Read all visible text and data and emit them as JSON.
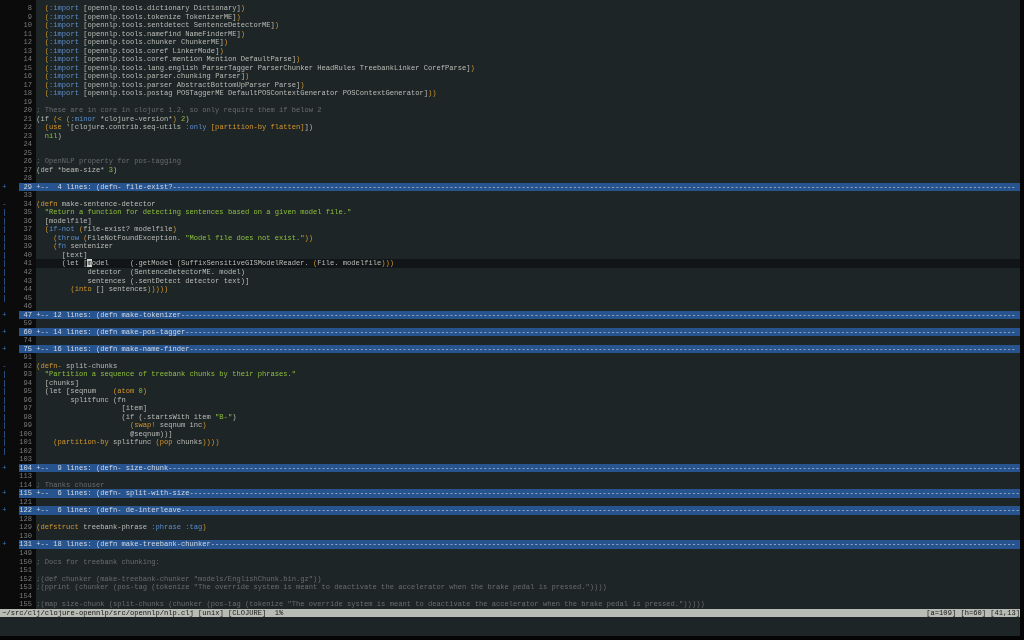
{
  "lines": [
    {
      "kind": "code",
      "number": "8",
      "current": false,
      "tokens": [
        {
          "kind": "paren",
          "text": "  ("
        },
        {
          "kind": "keyword",
          "text": ":import"
        },
        {
          "kind": "plain",
          "text": " [opennlp.tools.dictionary Dictionary]"
        },
        {
          "kind": "paren",
          "text": ")"
        }
      ]
    },
    {
      "kind": "code",
      "number": "9",
      "current": false,
      "tokens": [
        {
          "kind": "paren",
          "text": "  ("
        },
        {
          "kind": "keyword",
          "text": ":import"
        },
        {
          "kind": "plain",
          "text": " [opennlp.tools.tokenize TokenizerME]"
        },
        {
          "kind": "paren",
          "text": ")"
        }
      ]
    },
    {
      "kind": "code",
      "number": "10",
      "current": false,
      "tokens": [
        {
          "kind": "paren",
          "text": "  ("
        },
        {
          "kind": "keyword",
          "text": ":import"
        },
        {
          "kind": "plain",
          "text": " [opennlp.tools.sentdetect SentenceDetectorME]"
        },
        {
          "kind": "paren",
          "text": ")"
        }
      ]
    },
    {
      "kind": "code",
      "number": "11",
      "current": false,
      "tokens": [
        {
          "kind": "paren",
          "text": "  ("
        },
        {
          "kind": "keyword",
          "text": ":import"
        },
        {
          "kind": "plain",
          "text": " [opennlp.tools.namefind NameFinderME]"
        },
        {
          "kind": "paren",
          "text": ")"
        }
      ]
    },
    {
      "kind": "code",
      "number": "12",
      "current": false,
      "tokens": [
        {
          "kind": "paren",
          "text": "  ("
        },
        {
          "kind": "keyword",
          "text": ":import"
        },
        {
          "kind": "plain",
          "text": " [opennlp.tools.chunker ChunkerME]"
        },
        {
          "kind": "paren",
          "text": ")"
        }
      ]
    },
    {
      "kind": "code",
      "number": "13",
      "current": false,
      "tokens": [
        {
          "kind": "paren",
          "text": "  ("
        },
        {
          "kind": "keyword",
          "text": ":import"
        },
        {
          "kind": "plain",
          "text": " [opennlp.tools.coref LinkerMode]"
        },
        {
          "kind": "paren",
          "text": ")"
        }
      ]
    },
    {
      "kind": "code",
      "number": "14",
      "current": false,
      "tokens": [
        {
          "kind": "paren",
          "text": "  ("
        },
        {
          "kind": "keyword",
          "text": ":import"
        },
        {
          "kind": "plain",
          "text": " [opennlp.tools.coref.mention Mention DefaultParse]"
        },
        {
          "kind": "paren",
          "text": ")"
        }
      ]
    },
    {
      "kind": "code",
      "number": "15",
      "current": false,
      "tokens": [
        {
          "kind": "paren",
          "text": "  ("
        },
        {
          "kind": "keyword",
          "text": ":import"
        },
        {
          "kind": "plain",
          "text": " [opennlp.tools.lang.english ParserTagger ParserChunker HeadRules TreebankLinker CorefParse]"
        },
        {
          "kind": "paren",
          "text": ")"
        }
      ]
    },
    {
      "kind": "code",
      "number": "16",
      "current": false,
      "tokens": [
        {
          "kind": "paren",
          "text": "  ("
        },
        {
          "kind": "keyword",
          "text": ":import"
        },
        {
          "kind": "plain",
          "text": " [opennlp.tools.parser.chunking Parser]"
        },
        {
          "kind": "paren",
          "text": ")"
        }
      ]
    },
    {
      "kind": "code",
      "number": "17",
      "current": false,
      "tokens": [
        {
          "kind": "paren",
          "text": "  ("
        },
        {
          "kind": "keyword",
          "text": ":import"
        },
        {
          "kind": "plain",
          "text": " [opennlp.tools.parser AbstractBottomUpParser Parse]"
        },
        {
          "kind": "paren",
          "text": ")"
        }
      ]
    },
    {
      "kind": "code",
      "number": "18",
      "current": false,
      "tokens": [
        {
          "kind": "paren",
          "text": "  ("
        },
        {
          "kind": "keyword",
          "text": ":import"
        },
        {
          "kind": "plain",
          "text": " [opennlp.tools.postag POSTaggerME DefaultPOSContextGenerator POSContextGenerator]"
        },
        {
          "kind": "paren",
          "text": "))"
        }
      ]
    },
    {
      "kind": "code",
      "number": "19",
      "current": false
    },
    {
      "kind": "code",
      "number": "20",
      "current": false,
      "tokens": [
        {
          "kind": "comment",
          "text": "; These are in core in clojure 1.2, so only require them if below 2"
        }
      ]
    },
    {
      "kind": "code",
      "number": "21",
      "current": false,
      "tokens": [
        {
          "kind": "plain",
          "text": "(if "
        },
        {
          "kind": "paren",
          "text": "(<"
        },
        {
          "kind": "paren",
          "text": " ("
        },
        {
          "kind": "keyword",
          "text": ":minor"
        },
        {
          "kind": "plain",
          "text": " *clojure-version*"
        },
        {
          "kind": "paren",
          "text": ")"
        },
        {
          "kind": "constant",
          "text": " 2"
        },
        {
          "kind": "plain",
          "text": ")"
        }
      ]
    },
    {
      "kind": "code",
      "number": "22",
      "current": false,
      "tokens": [
        {
          "kind": "form",
          "text": "  (use"
        },
        {
          "kind": "plain",
          "text": " '[clojure.contrib.seq-utils "
        },
        {
          "kind": "keyword",
          "text": ":only"
        },
        {
          "kind": "form",
          "text": " [partition-by flatten]"
        },
        {
          "kind": "plain",
          "text": "])"
        }
      ]
    },
    {
      "kind": "code",
      "number": "23",
      "current": false,
      "tokens": [
        {
          "kind": "constant",
          "text": "  nil"
        },
        {
          "kind": "plain",
          "text": ")"
        }
      ]
    },
    {
      "kind": "code",
      "number": "24",
      "current": false
    },
    {
      "kind": "code",
      "number": "25",
      "current": false
    },
    {
      "kind": "code",
      "number": "26",
      "current": false,
      "tokens": [
        {
          "kind": "comment",
          "text": "; OpenNLP property for pos-tagging"
        }
      ]
    },
    {
      "kind": "code",
      "number": "27",
      "current": false,
      "tokens": [
        {
          "kind": "plain",
          "text": "(def *beam-size* "
        },
        {
          "kind": "constant",
          "text": "3"
        },
        {
          "kind": "plain",
          "text": ")"
        }
      ]
    },
    {
      "kind": "code",
      "number": "28",
      "current": false
    },
    {
      "kind": "folded",
      "number": "29",
      "fold_marker": "+",
      "current": false,
      "text": "+--  4 lines: (defn- file-exist?------------------------------------------------------------------------------------------------------------------------------------------------------------------------------------------------------"
    },
    {
      "kind": "code",
      "number": "33",
      "current": false
    },
    {
      "kind": "code",
      "number": "34",
      "fold_marker": "-",
      "current": false,
      "tokens": [
        {
          "kind": "form",
          "text": "(defn"
        },
        {
          "kind": "plain",
          "text": " make-sentence-detector"
        }
      ]
    },
    {
      "kind": "code",
      "number": "35",
      "fold_marker": "|",
      "current": false,
      "tokens": [
        {
          "kind": "string",
          "text": "  \"Return a function for detecting sentences based on a given model file.\""
        }
      ]
    },
    {
      "kind": "code",
      "number": "36",
      "fold_marker": "|",
      "current": false,
      "tokens": [
        {
          "kind": "plain",
          "text": "  [modelfile]"
        }
      ]
    },
    {
      "kind": "code",
      "number": "37",
      "fold_marker": "|",
      "current": false,
      "tokens": [
        {
          "kind": "paren",
          "text": "  ("
        },
        {
          "kind": "keyword",
          "text": "if-not"
        },
        {
          "kind": "paren",
          "text": " ("
        },
        {
          "kind": "plain",
          "text": "file-exist? modelfile"
        },
        {
          "kind": "paren",
          "text": ")"
        }
      ]
    },
    {
      "kind": "code",
      "number": "38",
      "fold_marker": "|",
      "current": false,
      "tokens": [
        {
          "kind": "paren",
          "text": "    ("
        },
        {
          "kind": "keyword",
          "text": "throw"
        },
        {
          "kind": "paren",
          "text": " ("
        },
        {
          "kind": "plain",
          "text": "FileNotFoundException. "
        },
        {
          "kind": "string",
          "text": "\"Model file does not exist.\""
        },
        {
          "kind": "paren",
          "text": "))"
        }
      ]
    },
    {
      "kind": "code",
      "number": "39",
      "fold_marker": "|",
      "current": false,
      "tokens": [
        {
          "kind": "paren",
          "text": "    ("
        },
        {
          "kind": "keyword",
          "text": "fn"
        },
        {
          "kind": "plain",
          "text": " sentenizer"
        }
      ]
    },
    {
      "kind": "code",
      "number": "40",
      "fold_marker": "|",
      "current": false,
      "tokens": [
        {
          "kind": "plain",
          "text": "      [text]"
        }
      ]
    },
    {
      "kind": "code",
      "number": "41",
      "fold_marker": "|",
      "current": true,
      "tokens": [
        {
          "kind": "plain",
          "text": "      (let ["
        },
        {
          "kind": "cursor",
          "text": "m"
        },
        {
          "kind": "plain",
          "text": "odel     (.getModel (SuffixSensitiveGISModelReader. "
        },
        {
          "kind": "paren",
          "text": "("
        },
        {
          "kind": "plain",
          "text": "File. modelfile"
        },
        {
          "kind": "paren",
          "text": ")))"
        }
      ]
    },
    {
      "kind": "code",
      "number": "42",
      "fold_marker": "|",
      "current": false,
      "tokens": [
        {
          "kind": "plain",
          "text": "            detector  (SentenceDetectorME. model)"
        }
      ]
    },
    {
      "kind": "code",
      "number": "43",
      "fold_marker": "|",
      "current": false,
      "tokens": [
        {
          "kind": "plain",
          "text": "            sentences (.sentDetect detector text)]"
        }
      ]
    },
    {
      "kind": "code",
      "number": "44",
      "fold_marker": "|",
      "current": false,
      "tokens": [
        {
          "kind": "form",
          "text": "        (into"
        },
        {
          "kind": "plain",
          "text": " [] sentences"
        },
        {
          "kind": "paren",
          "text": ")))))"
        }
      ]
    },
    {
      "kind": "code",
      "number": "45",
      "fold_marker": "|",
      "current": false
    },
    {
      "kind": "code",
      "number": "46",
      "current": false
    },
    {
      "kind": "folded",
      "number": "47",
      "fold_marker": "+",
      "current": false,
      "text": "+-- 12 lines: (defn make-tokenizer----------------------------------------------------------------------------------------------------------------------------------------------------------------------------------------------------"
    },
    {
      "kind": "code",
      "number": "59",
      "current": false
    },
    {
      "kind": "folded",
      "number": "60",
      "fold_marker": "+",
      "current": false,
      "text": "+-- 14 lines: (defn make-pos-tagger---------------------------------------------------------------------------------------------------------------------------------------------------------------------------------------------------"
    },
    {
      "kind": "code",
      "number": "74",
      "current": false
    },
    {
      "kind": "folded",
      "number": "75",
      "fold_marker": "+",
      "current": false,
      "text": "+-- 16 lines: (defn make-name-finder--------------------------------------------------------------------------------------------------------------------------------------------------------------------------------------------------"
    },
    {
      "kind": "code",
      "number": "91",
      "current": false
    },
    {
      "kind": "code",
      "number": "92",
      "fold_marker": "-",
      "current": false,
      "tokens": [
        {
          "kind": "form",
          "text": "(defn-"
        },
        {
          "kind": "plain",
          "text": " split-chunks"
        }
      ]
    },
    {
      "kind": "code",
      "number": "93",
      "fold_marker": "|",
      "current": false,
      "tokens": [
        {
          "kind": "string",
          "text": "  \"Partition a sequence of treebank chunks by their phrases.\""
        }
      ]
    },
    {
      "kind": "code",
      "number": "94",
      "fold_marker": "|",
      "current": false,
      "tokens": [
        {
          "kind": "plain",
          "text": "  [chunks]"
        }
      ]
    },
    {
      "kind": "code",
      "number": "95",
      "fold_marker": "|",
      "current": false,
      "tokens": [
        {
          "kind": "plain",
          "text": "  (let [seqnum    "
        },
        {
          "kind": "form",
          "text": "(atom"
        },
        {
          "kind": "constant",
          "text": " 0"
        },
        {
          "kind": "form",
          "text": ")"
        }
      ]
    },
    {
      "kind": "code",
      "number": "96",
      "fold_marker": "|",
      "current": false,
      "tokens": [
        {
          "kind": "plain",
          "text": "        splitfunc (fn"
        }
      ]
    },
    {
      "kind": "code",
      "number": "97",
      "fold_marker": "|",
      "current": false,
      "tokens": [
        {
          "kind": "plain",
          "text": "                    [item]"
        }
      ]
    },
    {
      "kind": "code",
      "number": "98",
      "fold_marker": "|",
      "current": false,
      "tokens": [
        {
          "kind": "plain",
          "text": "                    (if (.startsWith item "
        },
        {
          "kind": "string",
          "text": "\"B-\""
        },
        {
          "kind": "plain",
          "text": ")"
        }
      ]
    },
    {
      "kind": "code",
      "number": "99",
      "fold_marker": "|",
      "current": false,
      "tokens": [
        {
          "kind": "form",
          "text": "                      (swap!"
        },
        {
          "kind": "plain",
          "text": " seqnum inc"
        },
        {
          "kind": "form",
          "text": ")"
        }
      ]
    },
    {
      "kind": "code",
      "number": "100",
      "fold_marker": "|",
      "current": false,
      "tokens": [
        {
          "kind": "plain",
          "text": "                      @seqnum))]"
        }
      ]
    },
    {
      "kind": "code",
      "number": "101",
      "fold_marker": "|",
      "current": false,
      "tokens": [
        {
          "kind": "form",
          "text": "    (partition-by"
        },
        {
          "kind": "plain",
          "text": " splitfunc "
        },
        {
          "kind": "form",
          "text": "(pop"
        },
        {
          "kind": "plain",
          "text": " chunks"
        },
        {
          "kind": "form",
          "text": "))))"
        }
      ]
    },
    {
      "kind": "code",
      "number": "102",
      "fold_marker": "|",
      "current": false
    },
    {
      "kind": "code",
      "number": "103",
      "current": false
    },
    {
      "kind": "folded",
      "number": "104",
      "fold_marker": "+",
      "current": false,
      "text": "+--  9 lines: (defn- size-chunk--------------------------------------------------------------------------------------------------------------------------------------------------------------------------------------------------------"
    },
    {
      "kind": "code",
      "number": "113",
      "current": false
    },
    {
      "kind": "code",
      "number": "114",
      "current": false,
      "tokens": [
        {
          "kind": "comment",
          "text": "; Thanks chouser"
        }
      ]
    },
    {
      "kind": "folded",
      "number": "115",
      "fold_marker": "+",
      "current": false,
      "text": "+--  6 lines: (defn- split-with-size---------------------------------------------------------------------------------------------------------------------------------------------------------------------------------------------------"
    },
    {
      "kind": "code",
      "number": "121",
      "current": false
    },
    {
      "kind": "folded",
      "number": "122",
      "fold_marker": "+",
      "current": false,
      "text": "+--  6 lines: (defn- de-interleave-----------------------------------------------------------------------------------------------------------------------------------------------------------------------------------------------------"
    },
    {
      "kind": "code",
      "number": "128",
      "current": false
    },
    {
      "kind": "code",
      "number": "129",
      "current": false,
      "tokens": [
        {
          "kind": "form",
          "text": "(defstruct"
        },
        {
          "kind": "plain",
          "text": " treebank-phrase "
        },
        {
          "kind": "keyword",
          "text": ":phrase :tag"
        },
        {
          "kind": "form",
          "text": ")"
        }
      ]
    },
    {
      "kind": "code",
      "number": "130",
      "current": false
    },
    {
      "kind": "folded",
      "number": "131",
      "fold_marker": "+",
      "current": false,
      "text": "+-- 18 lines: (defn make-treebank-chunker---------------------------------------------------------------------------------------------------------------------------------------------------------------------------------------------"
    },
    {
      "kind": "code",
      "number": "149",
      "current": false
    },
    {
      "kind": "code",
      "number": "150",
      "current": false,
      "tokens": [
        {
          "kind": "comment",
          "text": "; Docs for treebank chunking:"
        }
      ]
    },
    {
      "kind": "code",
      "number": "151",
      "current": false
    },
    {
      "kind": "code",
      "number": "152",
      "current": false,
      "tokens": [
        {
          "kind": "comment",
          "text": ";(def chunker (make-treebank-chunker \"models/EnglishChunk.bin.gz\"))"
        }
      ]
    },
    {
      "kind": "code",
      "number": "153",
      "current": false,
      "tokens": [
        {
          "kind": "comment",
          "text": ";(pprint (chunker (pos-tag (tokenize \"The override system is meant to deactivate the accelerator when the brake pedal is pressed.\"))))"
        }
      ]
    },
    {
      "kind": "code",
      "number": "154",
      "current": false
    },
    {
      "kind": "code",
      "number": "155",
      "current": false,
      "tokens": [
        {
          "kind": "comment",
          "text": ";(map size-chunk (split-chunks (chunker (pos-tag (tokenize \"The override system is meant to deactivate the accelerator when the brake pedal is pressed.\")))))"
        }
      ]
    }
  ],
  "status_bar": {
    "left": "~/src/clj/clojure-opennlp/src/opennlp/nlp.clj [unix] [CLOJURE]  1%",
    "right": "[a=109] [h=60] [41,13]"
  }
}
